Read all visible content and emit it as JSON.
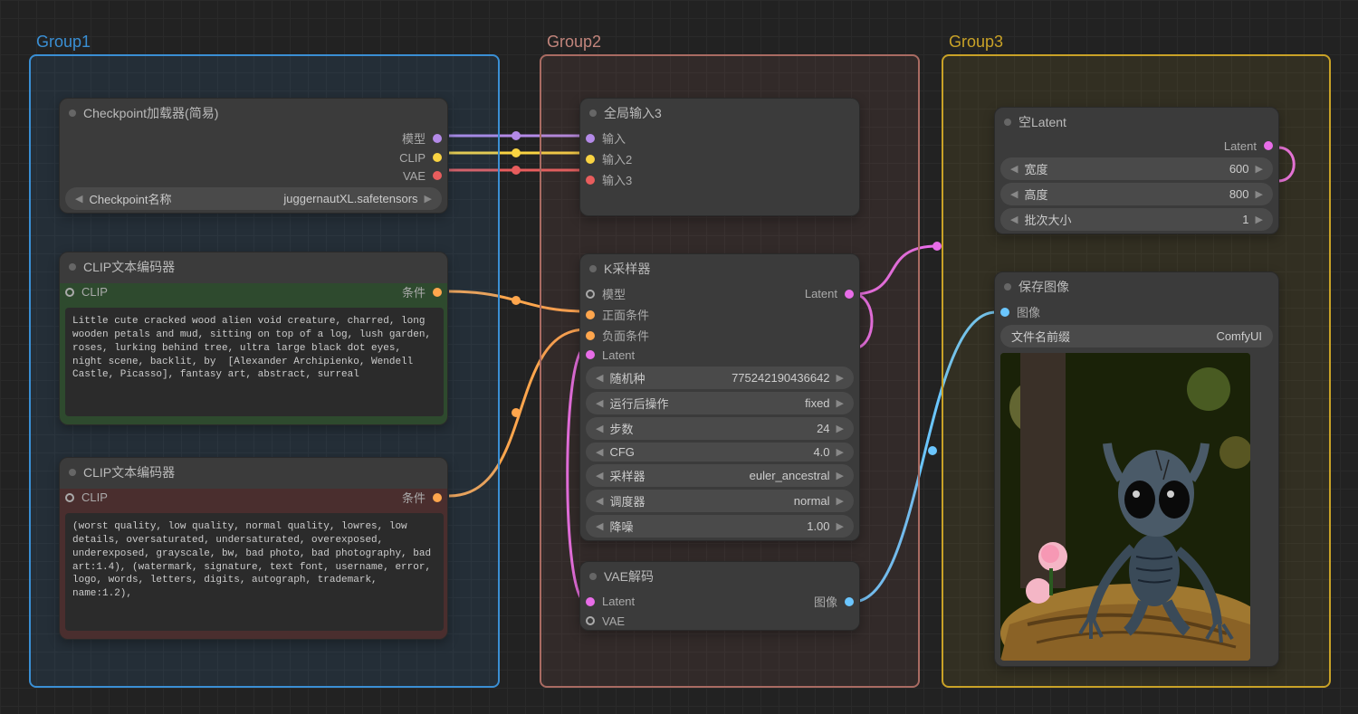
{
  "groups": {
    "g1": {
      "title": "Group1",
      "color": "#3a8fd4"
    },
    "g2": {
      "title": "Group2",
      "color": "#a96b62"
    },
    "g3": {
      "title": "Group3",
      "color": "#c9a227"
    }
  },
  "nodes": {
    "checkpoint": {
      "title": "Checkpoint加载器(简易)",
      "outputs": {
        "model": "模型",
        "clip": "CLIP",
        "vae": "VAE"
      },
      "param_name": "Checkpoint名称",
      "param_value": "juggernautXL.safetensors"
    },
    "clip_pos": {
      "title": "CLIP文本编码器",
      "in_clip": "CLIP",
      "out_cond": "条件",
      "text": "Little cute cracked wood alien void creature, charred, long wooden petals and mud, sitting on top of a log, lush garden, roses, lurking behind tree, ultra large black dot eyes, night scene, backlit, by  [Alexander Archipienko, Wendell Castle, Picasso], fantasy art, abstract, surreal"
    },
    "clip_neg": {
      "title": "CLIP文本编码器",
      "in_clip": "CLIP",
      "out_cond": "条件",
      "text": "(worst quality, low quality, normal quality, lowres, low details, oversaturated, undersaturated, overexposed, underexposed, grayscale, bw, bad photo, bad photography, bad art:1.4), (watermark, signature, text font, username, error, logo, words, letters, digits, autograph, trademark, name:1.2),"
    },
    "reroute": {
      "title": "全局输入3",
      "in1": "输入",
      "in2": "输入2",
      "in3": "输入3"
    },
    "ksampler": {
      "title": "K采样器",
      "in_model": "模型",
      "in_pos": "正面条件",
      "in_neg": "负面条件",
      "in_latent": "Latent",
      "out_latent": "Latent",
      "params": {
        "seed": {
          "name": "随机种",
          "value": "775242190436642"
        },
        "after": {
          "name": "运行后操作",
          "value": "fixed"
        },
        "steps": {
          "name": "步数",
          "value": "24"
        },
        "cfg": {
          "name": "CFG",
          "value": "4.0"
        },
        "sampler": {
          "name": "采样器",
          "value": "euler_ancestral"
        },
        "sched": {
          "name": "调度器",
          "value": "normal"
        },
        "denoise": {
          "name": "降噪",
          "value": "1.00"
        }
      }
    },
    "vaedec": {
      "title": "VAE解码",
      "in_latent": "Latent",
      "in_vae": "VAE",
      "out_img": "图像"
    },
    "emptylat": {
      "title": "空Latent",
      "out_latent": "Latent",
      "params": {
        "width": {
          "name": "宽度",
          "value": "600"
        },
        "height": {
          "name": "高度",
          "value": "800"
        },
        "batch": {
          "name": "批次大小",
          "value": "1"
        }
      }
    },
    "save": {
      "title": "保存图像",
      "in_img": "图像",
      "param_name": "文件名前缀",
      "param_value": "ComfyUI"
    }
  }
}
